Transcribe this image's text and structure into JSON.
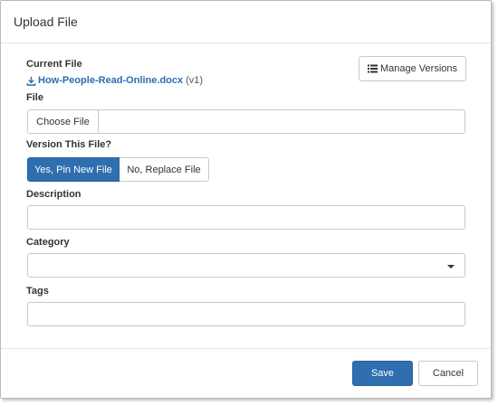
{
  "dialog": {
    "title": "Upload File"
  },
  "current_file": {
    "label": "Current File",
    "file_name": "How-People-Read-Online.docx",
    "version": "(v1)",
    "manage_versions_label": "Manage Versions"
  },
  "file": {
    "label": "File",
    "choose_button_label": "Choose File",
    "value": ""
  },
  "versioning": {
    "label": "Version This File?",
    "options": [
      "Yes, Pin New File",
      "No, Replace File"
    ],
    "selected": "Yes, Pin New File"
  },
  "description": {
    "label": "Description",
    "value": ""
  },
  "category": {
    "label": "Category",
    "selected": ""
  },
  "tags": {
    "label": "Tags",
    "value": ""
  },
  "footer": {
    "save_label": "Save",
    "cancel_label": "Cancel"
  },
  "colors": {
    "primary": "#2f6eaf",
    "link": "#2a6eb3"
  },
  "icons": {
    "download": "download-icon",
    "list": "list-icon",
    "dropdown": "caret-down-icon"
  }
}
